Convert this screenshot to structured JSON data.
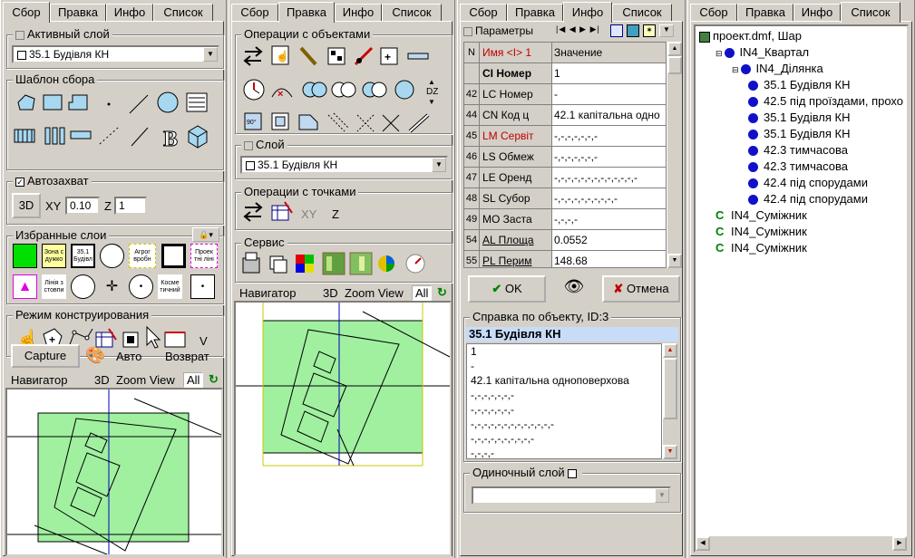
{
  "tabs": [
    "Сбор",
    "Правка",
    "Инфо",
    "Список"
  ],
  "p1": {
    "active_layer": {
      "title": "Активный слой",
      "value": "35.1 Будівля КН"
    },
    "template": {
      "title": "Шаблон сбора"
    },
    "autocap": {
      "title": "Автозахват",
      "mode": "3D",
      "xy_label": "XY",
      "xy": "0.10",
      "z_label": "Z",
      "z": "1"
    },
    "fav": {
      "title": "Избранные слои",
      "items": [
        "",
        "Зона с дужко",
        "35.1 Будівл",
        "",
        "Агрог вробн",
        "",
        "Проек тні ліні",
        "",
        "Лінія з стовпи",
        "",
        "",
        "",
        "Косме тичний",
        ""
      ]
    },
    "construct": {
      "title": "Режим конструирования",
      "v": "V"
    },
    "capture": "Capture",
    "avto": "Авто",
    "back": "Возврат",
    "nav": {
      "title": "Навигатор",
      "d3": "3D",
      "zoom": "Zoom View",
      "all": "All"
    }
  },
  "p2": {
    "ops": {
      "title": "Операции с объектами"
    },
    "layer": {
      "title": "Слой",
      "value": "35.1 Будівля КН"
    },
    "pts": {
      "title": "Операции с точками",
      "xy": "XY",
      "z": "Z"
    },
    "svc": {
      "title": "Сервис"
    },
    "nav": {
      "title": "Навигатор",
      "d3": "3D",
      "zoom": "Zoom View",
      "all": "All"
    }
  },
  "p3": {
    "params": "Параметры",
    "hdr": {
      "n": "N",
      "name": "Имя <I> 1",
      "val": "Значение"
    },
    "rows": [
      {
        "n": "",
        "a": "CI Номер",
        "b": "1",
        "red": false,
        "bold": true,
        "u": false
      },
      {
        "n": "42",
        "a": "LC Номер",
        "b": "-",
        "red": false,
        "bold": false,
        "u": false
      },
      {
        "n": "44",
        "a": "CN Код ц",
        "b": "42.1 капітальна одно",
        "red": false,
        "bold": false,
        "u": false
      },
      {
        "n": "45",
        "a": "LM Сервіт",
        "b": "-,-,-,-,-,-,-",
        "red": true,
        "bold": false,
        "u": false
      },
      {
        "n": "46",
        "a": "LS Обмеж",
        "b": "-,-,-,-,-,-,-",
        "red": false,
        "bold": false,
        "u": false
      },
      {
        "n": "47",
        "a": "LE Оренд",
        "b": "-,-,-,-,-,-,-,-,-,-,-,-,-",
        "red": false,
        "bold": false,
        "u": false
      },
      {
        "n": "48",
        "a": "SL Субор",
        "b": "-,-,-,-,-,-,-,-,-,-",
        "red": false,
        "bold": false,
        "u": false
      },
      {
        "n": "49",
        "a": "MO Заста",
        "b": "-,-,-,-",
        "red": false,
        "bold": false,
        "u": false
      },
      {
        "n": "54",
        "a": "AL Площа",
        "b": "0.0552",
        "red": false,
        "bold": false,
        "u": true
      },
      {
        "n": "55",
        "a": "PL Перим",
        "b": "148.68",
        "red": false,
        "bold": false,
        "u": true
      }
    ],
    "ok": "OK",
    "cancel": "Отмена",
    "info": {
      "title": "Справка по объекту, ID:3",
      "name": "35.1 Будівля КН",
      "lines": [
        "1",
        "-",
        "42.1 капітальна одноповерхова",
        "-,-,-,-,-,-,-",
        "-,-,-,-,-,-,-",
        "-,-,-,-,-,-,-,-,-,-,-,-,-",
        "-,-,-,-,-,-,-,-,-,-",
        "-,-,-,-"
      ]
    },
    "single": {
      "title": "Одиночный слой"
    }
  },
  "p4": {
    "tree": [
      {
        "t": "проект.dmf, Шар",
        "lvl": 0,
        "k": "root"
      },
      {
        "t": "IN4_Квартал",
        "lvl": 1,
        "k": "dot"
      },
      {
        "t": "IN4_Ділянка",
        "lvl": 2,
        "k": "dot"
      },
      {
        "t": "35.1 Будівля КН",
        "lvl": 3,
        "k": "dot"
      },
      {
        "t": "42.5 під проїздами, прохо",
        "lvl": 3,
        "k": "dot"
      },
      {
        "t": "35.1 Будівля КН",
        "lvl": 3,
        "k": "dot"
      },
      {
        "t": "35.1 Будівля КН",
        "lvl": 3,
        "k": "dot"
      },
      {
        "t": "42.3 тимчасова",
        "lvl": 3,
        "k": "dot"
      },
      {
        "t": "42.3 тимчасова",
        "lvl": 3,
        "k": "dot"
      },
      {
        "t": "42.4 під спорудами",
        "lvl": 3,
        "k": "dot"
      },
      {
        "t": "42.4 під спорудами",
        "lvl": 3,
        "k": "dot"
      },
      {
        "t": "IN4_Суміжник",
        "lvl": 1,
        "k": "c"
      },
      {
        "t": "IN4_Суміжник",
        "lvl": 1,
        "k": "c"
      },
      {
        "t": "IN4_Суміжник",
        "lvl": 1,
        "k": "c"
      }
    ]
  }
}
